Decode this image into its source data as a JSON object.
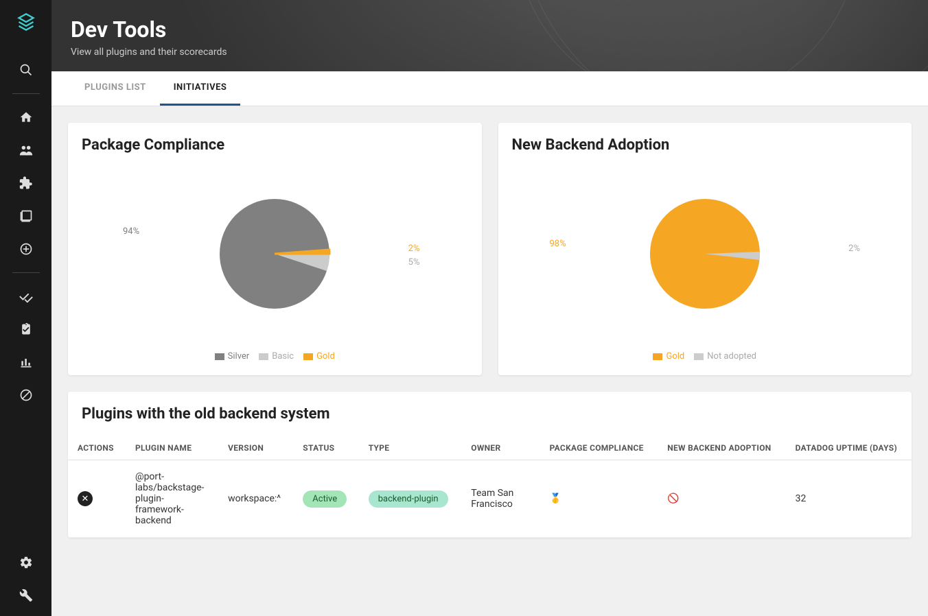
{
  "header": {
    "title": "Dev Tools",
    "subtitle": "View all plugins and their scorecards"
  },
  "tabs": [
    {
      "label": "Plugins List",
      "active": false
    },
    {
      "label": "Initiatives",
      "active": true
    }
  ],
  "chart_data": [
    {
      "type": "pie",
      "title": "Package Compliance",
      "series": [
        {
          "name": "Silver",
          "value": 94,
          "color": "#808080"
        },
        {
          "name": "Basic",
          "value": 5,
          "color": "#cccccc"
        },
        {
          "name": "Gold",
          "value": 2,
          "color": "#f5a623"
        }
      ],
      "legend": [
        "Silver",
        "Basic",
        "Gold"
      ]
    },
    {
      "type": "pie",
      "title": "New Backend Adoption",
      "series": [
        {
          "name": "Gold",
          "value": 98,
          "color": "#f5a623"
        },
        {
          "name": "Not adopted",
          "value": 2,
          "color": "#cccccc"
        }
      ],
      "legend": [
        "Gold",
        "Not adopted"
      ]
    }
  ],
  "table": {
    "title": "Plugins with the old backend system",
    "columns": [
      "Actions",
      "Plugin Name",
      "Version",
      "Status",
      "Type",
      "Owner",
      "Package Compliance",
      "New Backend Adoption",
      "Datadog Uptime (Days)"
    ],
    "rows": [
      {
        "plugin_name": "@port-labs/backstage-plugin-framework-backend",
        "version": "workspace:^",
        "status": "Active",
        "type": "backend-plugin",
        "owner": "Team San Francisco",
        "package_compliance_icon": "🥇",
        "new_backend_adoption_icon": "🚫",
        "datadog_uptime": "32"
      }
    ]
  },
  "colors": {
    "silver": "#808080",
    "basic": "#cccccc",
    "gold": "#f5a623"
  }
}
